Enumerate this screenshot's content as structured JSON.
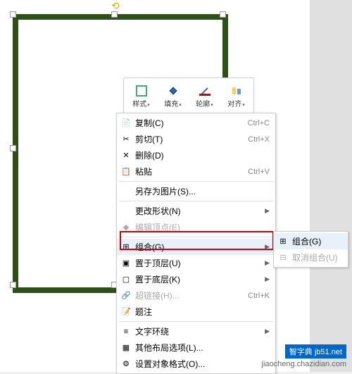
{
  "toolbar": {
    "style": "样式",
    "fill": "填充",
    "outline": "轮廓",
    "align": "对齐"
  },
  "menu": {
    "copy": {
      "label": "复制(C)",
      "shortcut": "Ctrl+C"
    },
    "cut": {
      "label": "剪切(T)",
      "shortcut": "Ctrl+X"
    },
    "delete": {
      "label": "删除(D)"
    },
    "paste": {
      "label": "粘贴",
      "shortcut": "Ctrl+V"
    },
    "saveAsPic": {
      "label": "另存为图片(S)..."
    },
    "changeShape": {
      "label": "更改形状(N)"
    },
    "editPoints": {
      "label": "编辑顶点(E)"
    },
    "group": {
      "label": "组合(G)"
    },
    "bringFront": {
      "label": "置于顶层(U)"
    },
    "sendBack": {
      "label": "置于底层(K)"
    },
    "hyperlink": {
      "label": "超链接(H)...",
      "shortcut": "Ctrl+K"
    },
    "caption": {
      "label": "题注"
    },
    "textWrap": {
      "label": "文字环绕"
    },
    "moreLayout": {
      "label": "其他布局选项(L)..."
    },
    "formatObject": {
      "label": "设置对象格式(O)..."
    }
  },
  "submenu": {
    "group": {
      "label": "组合(G)"
    },
    "ungroup": {
      "label": "取消组合(U)"
    }
  },
  "watermark": {
    "site": "智字典 jb51.net",
    "domain": "jiaocheng.chazidian.com"
  }
}
